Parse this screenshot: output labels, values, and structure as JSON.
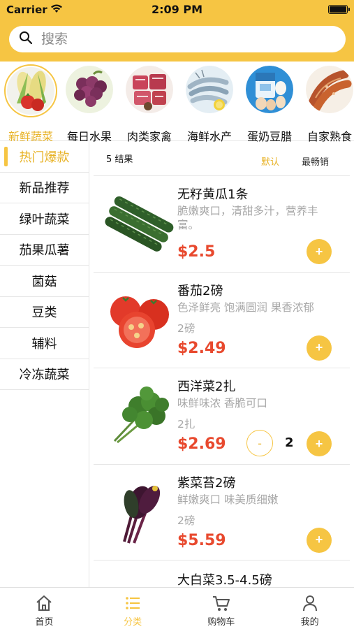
{
  "status": {
    "carrier": "Carrier",
    "time": "2:09 PM"
  },
  "search": {
    "placeholder": "搜索"
  },
  "categories": [
    {
      "label": "新鲜蔬菜",
      "icon": "vegetables-icon",
      "active": true
    },
    {
      "label": "每日水果",
      "icon": "grapes-icon",
      "active": false
    },
    {
      "label": "肉类家禽",
      "icon": "meat-icon",
      "active": false
    },
    {
      "label": "海鲜水产",
      "icon": "shrimp-icon",
      "active": false
    },
    {
      "label": "蛋奶豆腊",
      "icon": "eggs-milk-icon",
      "active": false
    },
    {
      "label": "自家熟食",
      "icon": "sausage-icon",
      "active": false
    }
  ],
  "sidebar": {
    "items": [
      {
        "label": "热门爆款",
        "active": true
      },
      {
        "label": "新品推荐"
      },
      {
        "label": "绿叶蔬菜"
      },
      {
        "label": "茄果瓜薯"
      },
      {
        "label": "菌菇"
      },
      {
        "label": "豆类"
      },
      {
        "label": "辅料"
      },
      {
        "label": "冷冻蔬菜"
      }
    ]
  },
  "list": {
    "result_count": "5 结果",
    "sort_default": "默认",
    "sort_best": "最畅销",
    "products": [
      {
        "name": "无籽黄瓜1条",
        "desc": "脆嫩爽口，清甜多汁，营养丰富。",
        "unit": "",
        "price": "$2.5",
        "image": "cucumber-image",
        "plus": "+"
      },
      {
        "name": "番茄2磅",
        "desc": "色泽鲜亮 饱满圆润 果香浓郁",
        "unit": "2磅",
        "price": "$2.49",
        "image": "tomato-image",
        "plus": "+"
      },
      {
        "name": "西洋菜2扎",
        "desc": "味鲜味浓  香脆可口",
        "unit": "2扎",
        "price": "$2.69",
        "image": "watercress-image",
        "plus": "+",
        "minus": "-",
        "qty": "2"
      },
      {
        "name": "紫菜苔2磅",
        "desc": "鲜嫩爽口 味美质细嫩",
        "unit": "2磅",
        "price": "$5.59",
        "image": "purple-cabbage-image",
        "plus": "+"
      },
      {
        "name": "大白菜3.5-4.5磅",
        "desc": "",
        "unit": "",
        "price": "",
        "image": ""
      }
    ]
  },
  "tabs": [
    {
      "label": "首页",
      "icon": "home-icon"
    },
    {
      "label": "分类",
      "icon": "list-icon",
      "active": true
    },
    {
      "label": "购物车",
      "icon": "cart-icon"
    },
    {
      "label": "我的",
      "icon": "user-icon"
    }
  ],
  "colors": {
    "accent": "#F6C543",
    "accent_text": "#E8B328",
    "price": "#E8492E",
    "muted": "#A8A8A8"
  }
}
